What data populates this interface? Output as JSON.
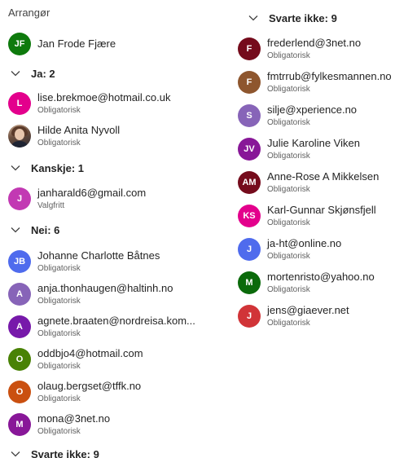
{
  "organizer": {
    "heading": "Arrangør",
    "person": {
      "initials": "JF",
      "name": "Jan Frode Fjære",
      "color": "#0e7a0d"
    }
  },
  "groups": {
    "ja": {
      "label": "Ja: 2"
    },
    "kanskje": {
      "label": "Kanskje: 1"
    },
    "nei": {
      "label": "Nei: 6"
    },
    "svarte_ikke": {
      "label": "Svarte ikke: 9"
    }
  },
  "ja_people": [
    {
      "initials": "L",
      "name": "lise.brekmoe@hotmail.co.uk",
      "role": "Obligatorisk",
      "color": "#e3008c"
    },
    {
      "initials": "",
      "name": "Hilde Anita Nyvoll",
      "role": "Obligatorisk",
      "color": "#6b4e3d",
      "icon": "photo-avatar"
    }
  ],
  "kanskje_people": [
    {
      "initials": "J",
      "name": "janharald6@gmail.com",
      "role": "Valgfritt",
      "color": "#c239b3"
    }
  ],
  "nei_people": [
    {
      "initials": "JB",
      "name": "Johanne Charlotte Båtnes",
      "role": "Obligatorisk",
      "color": "#4f6bed"
    },
    {
      "initials": "A",
      "name": "anja.thonhaugen@haltinh.no",
      "role": "Obligatorisk",
      "color": "#8764b8"
    },
    {
      "initials": "A",
      "name": "agnete.braaten@nordreisa.kom...",
      "role": "Obligatorisk",
      "color": "#7719aa"
    },
    {
      "initials": "O",
      "name": "oddbjo4@hotmail.com",
      "role": "Obligatorisk",
      "color": "#498205"
    },
    {
      "initials": "O",
      "name": "olaug.bergset@tffk.no",
      "role": "Obligatorisk",
      "color": "#ca5010"
    },
    {
      "initials": "M",
      "name": "mona@3net.no",
      "role": "Obligatorisk",
      "color": "#881798"
    }
  ],
  "svarte_ikke_people": [
    {
      "initials": "F",
      "name": "frederlend@3net.no",
      "role": "Obligatorisk",
      "color": "#750b1c"
    },
    {
      "initials": "F",
      "name": "fmtrrub@fylkesmannen.no",
      "role": "Obligatorisk",
      "color": "#8e562e"
    },
    {
      "initials": "S",
      "name": "silje@xperience.no",
      "role": "Obligatorisk",
      "color": "#8764b8"
    },
    {
      "initials": "JV",
      "name": "Julie Karoline Viken",
      "role": "Obligatorisk",
      "color": "#881798"
    },
    {
      "initials": "AM",
      "name": "Anne-Rose A Mikkelsen",
      "role": "Obligatorisk",
      "color": "#750b1c"
    },
    {
      "initials": "KS",
      "name": "Karl-Gunnar Skjønsfjell",
      "role": "Obligatorisk",
      "color": "#e3008c"
    },
    {
      "initials": "J",
      "name": "ja-ht@online.no",
      "role": "Obligatorisk",
      "color": "#4f6bed"
    },
    {
      "initials": "M",
      "name": "mortenristo@yahoo.no",
      "role": "Obligatorisk",
      "color": "#0b6a0b"
    },
    {
      "initials": "J",
      "name": "jens@giaever.net",
      "role": "Obligatorisk",
      "color": "#d13438"
    }
  ]
}
